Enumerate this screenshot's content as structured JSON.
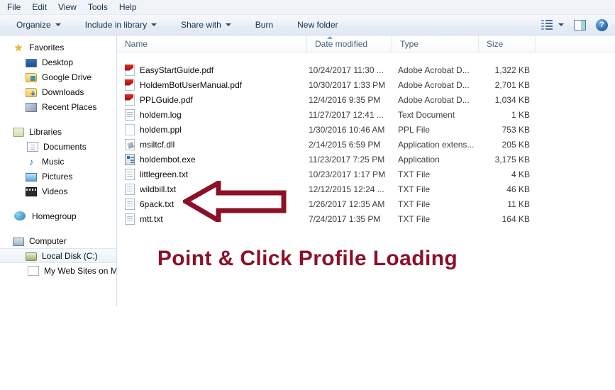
{
  "window": {
    "menubar": [
      {
        "label": "File"
      },
      {
        "label": "Edit"
      },
      {
        "label": "View"
      },
      {
        "label": "Tools"
      },
      {
        "label": "Help"
      }
    ],
    "commandbar": {
      "organize": "Organize",
      "include_in_library": "Include in library",
      "share_with": "Share with",
      "burn": "Burn",
      "new_folder": "New folder",
      "views_icon": "views-icon",
      "views_caret_icon": "chevron-down-icon",
      "preview_pane_icon": "preview-pane-icon",
      "help_icon": "help-icon",
      "help_glyph": "?"
    }
  },
  "navpane": {
    "groups": [
      {
        "root": {
          "label": "Favorites",
          "icon": "star-icon"
        },
        "children": [
          {
            "label": "Desktop",
            "icon": "desktop-icon"
          },
          {
            "label": "Google Drive",
            "icon": "google-drive-folder-icon"
          },
          {
            "label": "Downloads",
            "icon": "downloads-folder-icon"
          },
          {
            "label": "Recent Places",
            "icon": "recent-places-icon"
          }
        ]
      },
      {
        "root": {
          "label": "Libraries",
          "icon": "libraries-icon"
        },
        "children": [
          {
            "label": "Documents",
            "icon": "documents-icon"
          },
          {
            "label": "Music",
            "icon": "music-note-icon"
          },
          {
            "label": "Pictures",
            "icon": "pictures-icon"
          },
          {
            "label": "Videos",
            "icon": "videos-film-icon"
          }
        ]
      },
      {
        "root": {
          "label": "Homegroup",
          "icon": "homegroup-icon"
        },
        "children": []
      },
      {
        "root": {
          "label": "Computer",
          "icon": "computer-icon"
        },
        "children": [
          {
            "label": "Local Disk (C:)",
            "icon": "hard-disk-icon",
            "selected": true
          },
          {
            "label": "My Web Sites on MS",
            "icon": "page-icon"
          }
        ]
      }
    ]
  },
  "filelist": {
    "columns": [
      {
        "key": "name",
        "label": "Name",
        "sorted": "ascending"
      },
      {
        "key": "date",
        "label": "Date modified"
      },
      {
        "key": "type",
        "label": "Type"
      },
      {
        "key": "size",
        "label": "Size"
      }
    ],
    "rows": [
      {
        "icon": "pdf-file-icon",
        "name": "EasyStartGuide.pdf",
        "date": "10/24/2017 11:30 ...",
        "type": "Adobe Acrobat D...",
        "size": "1,322 KB"
      },
      {
        "icon": "pdf-file-icon",
        "name": "HoldemBotUserManual.pdf",
        "date": "10/30/2017 1:33 PM",
        "type": "Adobe Acrobat D...",
        "size": "2,701 KB"
      },
      {
        "icon": "pdf-file-icon",
        "name": "PPLGuide.pdf",
        "date": "12/4/2016 9:35 PM",
        "type": "Adobe Acrobat D...",
        "size": "1,034 KB"
      },
      {
        "icon": "text-file-icon",
        "name": "holdem.log",
        "date": "11/27/2017 12:41 ...",
        "type": "Text Document",
        "size": "1 KB"
      },
      {
        "icon": "plain-file-icon",
        "name": "holdem.ppl",
        "date": "1/30/2016 10:46 AM",
        "type": "PPL File",
        "size": "753 KB"
      },
      {
        "icon": "dll-file-icon",
        "name": "msiltcf.dll",
        "date": "2/14/2015 6:59 PM",
        "type": "Application extens...",
        "size": "205 KB"
      },
      {
        "icon": "exe-file-icon",
        "name": "holdembot.exe",
        "date": "11/23/2017 7:25 PM",
        "type": "Application",
        "size": "3,175 KB"
      },
      {
        "icon": "text-file-icon",
        "name": "littlegreen.txt",
        "date": "10/23/2017 1:17 PM",
        "type": "TXT File",
        "size": "4 KB"
      },
      {
        "icon": "text-file-icon",
        "name": "wildbill.txt",
        "date": "12/12/2015 12:24 ...",
        "type": "TXT File",
        "size": "46 KB"
      },
      {
        "icon": "text-file-icon",
        "name": "6pack.txt",
        "date": "1/26/2017 12:35 AM",
        "type": "TXT File",
        "size": "11 KB"
      },
      {
        "icon": "text-file-icon",
        "name": "mtt.txt",
        "date": "7/24/2017 1:35 PM",
        "type": "TXT File",
        "size": "164 KB"
      }
    ]
  },
  "annotation": {
    "arrow_icon": "left-pointing-arrow-annotation",
    "arrow_color": "#8c1128",
    "caption": "Point & Click Profile Loading",
    "caption_color": "#8c1128"
  }
}
